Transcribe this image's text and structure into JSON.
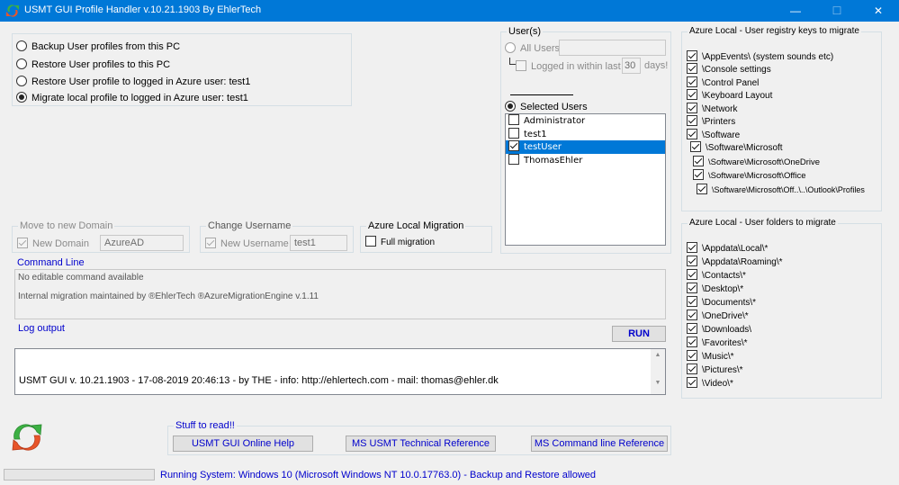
{
  "window": {
    "title": "USMT GUI Profile Handler v.10.21.1903 By EhlerTech",
    "minimize": "—",
    "maximize": "☐",
    "close": "✕"
  },
  "modes": [
    {
      "label": "Backup User profiles from this PC",
      "selected": false
    },
    {
      "label": "Restore User profiles to this PC",
      "selected": false
    },
    {
      "label": "Restore User profile to logged in Azure user: test1",
      "selected": false
    },
    {
      "label": "Migrate local profile to logged in Azure user: test1",
      "selected": true
    }
  ],
  "users": {
    "legend": "User(s)",
    "all_users_label": "All Users",
    "all_users_value": "",
    "logged_within_label": "Logged in within last",
    "days_value": "30",
    "days_label": "days!",
    "selected_users_label": "Selected Users",
    "list": [
      {
        "name": "Administrator",
        "checked": false,
        "selected": false
      },
      {
        "name": "test1",
        "checked": false,
        "selected": false
      },
      {
        "name": "testUser",
        "checked": true,
        "selected": true
      },
      {
        "name": "ThomasEhler",
        "checked": false,
        "selected": false
      }
    ]
  },
  "domain": {
    "legend": "Move to new Domain",
    "checkbox_label": "New Domain",
    "value": "AzureAD"
  },
  "username": {
    "legend": "Change Username",
    "checkbox_label": "New Username",
    "value": "test1"
  },
  "azure_migration": {
    "legend": "Azure Local Migration",
    "checkbox_label": "Full migration"
  },
  "command_line": {
    "legend": "Command Line",
    "line1": "No editable command available",
    "line2": "Internal migration maintained by ®EhlerTech ®AzureMigrationEngine v.1.11"
  },
  "log": {
    "label": "Log output",
    "run_label": "RUN",
    "text": "USMT GUI v. 10.21.1903  - 17-08-2019 20:46:13 - by THE - info: http://ehlertech.com - mail: thomas@ehler.dk"
  },
  "registry": {
    "legend": "Azure Local - User registry keys to migrate",
    "items": [
      "\\AppEvents\\ (system sounds etc)",
      "\\Console settings",
      "\\Control Panel",
      "\\Keyboard Layout",
      "\\Network",
      "\\Printers",
      "\\Software",
      "\\Software\\Microsoft",
      "\\Software\\Microsoft\\OneDrive",
      "\\Software\\Microsoft\\Office",
      "\\Software\\Microsoft\\Off..\\..\\Outlook\\Profiles"
    ]
  },
  "folders": {
    "legend": "Azure Local - User folders to migrate",
    "items": [
      "\\Appdata\\Local\\*",
      "\\Appdata\\Roaming\\*",
      "\\Contacts\\*",
      "\\Desktop\\*",
      "\\Documents\\*",
      "\\OneDrive\\*",
      "\\Downloads\\",
      "\\Favorites\\*",
      "\\Music\\*",
      "\\Pictures\\*",
      "\\Video\\*"
    ]
  },
  "reading": {
    "legend": "Stuff to read!!",
    "buttons": [
      "USMT GUI Online Help",
      "MS USMT Technical Reference",
      "MS Command line Reference"
    ]
  },
  "status": {
    "text": "Running System: Windows 10  (Microsoft Windows NT 10.0.17763.0) - Backup and Restore allowed"
  },
  "colors": {
    "titlebar": "#0078d7",
    "selection": "#0078d7",
    "link_blue": "#0000cc"
  }
}
